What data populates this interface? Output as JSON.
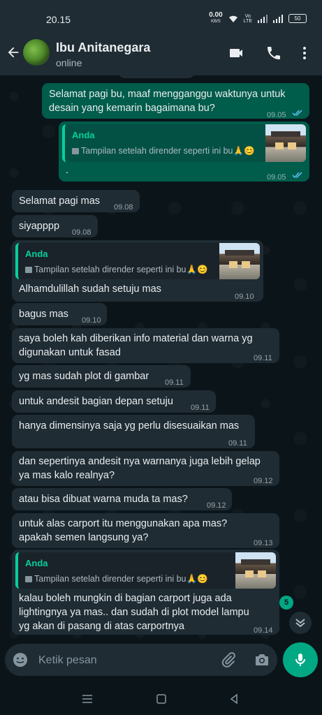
{
  "status_bar": {
    "time": "20.15",
    "net_speed_value": "0.00",
    "net_speed_unit": "KB/S",
    "volte_top": "Vo",
    "volte_bottom": "LTE",
    "battery": "50"
  },
  "header": {
    "contact_name": "Ibu Anitanegara",
    "presence": "online"
  },
  "colors": {
    "header_bg": "#1f2c34",
    "incoming_bubble": "#1f2c34",
    "outgoing_bubble": "#005c4b",
    "accent": "#00a884",
    "read_ticks": "#53bdeb",
    "quote_author": "#06cf9c"
  },
  "messages": [
    {
      "dir": "out",
      "lines": [
        "Selamat pagi bu, maaf mengganggu waktunya untuk",
        "desain yang kemarin bagaimana bu?"
      ],
      "time": "09.05",
      "status": "read"
    },
    {
      "dir": "out",
      "quote": {
        "author": "Anda",
        "text": "Tampilan setelah dirender seperti ini bu🙏😊"
      },
      "lines": [
        "."
      ],
      "time": "09.05",
      "status": "read"
    },
    {
      "dir": "in",
      "lines": [
        "Selamat pagi mas"
      ],
      "time": "09.08"
    },
    {
      "dir": "in",
      "lines": [
        "siyapppp"
      ],
      "time": "09.08"
    },
    {
      "dir": "in",
      "quote": {
        "author": "Anda",
        "text": "Tampilan setelah dirender seperti ini bu🙏😊"
      },
      "lines": [
        "Alhamdulillah sudah setuju mas"
      ],
      "time": "09.10"
    },
    {
      "dir": "in",
      "lines": [
        "bagus mas"
      ],
      "time": "09.10"
    },
    {
      "dir": "in",
      "lines": [
        "saya boleh kah diberikan info material dan warna yg",
        "digunakan untuk fasad"
      ],
      "time": "09.11"
    },
    {
      "dir": "in",
      "lines": [
        "yg mas sudah plot di gambar"
      ],
      "time": "09.11"
    },
    {
      "dir": "in",
      "lines": [
        "untuk andesit bagian depan setuju"
      ],
      "time": "09.11"
    },
    {
      "dir": "in",
      "lines": [
        "hanya dimensinya saja yg perlu disesuaikan mas"
      ],
      "time": "09.11"
    },
    {
      "dir": "in",
      "lines": [
        "dan sepertinya andesit nya warnanya juga lebih gelap",
        "ya mas kalo realnya?"
      ],
      "time": "09.12"
    },
    {
      "dir": "in",
      "lines": [
        "atau bisa dibuat warna muda ta mas?"
      ],
      "time": "09.12"
    },
    {
      "dir": "in",
      "lines": [
        "untuk alas carport itu menggunakan apa mas?",
        "apakah semen langsung ya?"
      ],
      "time": "09.13"
    },
    {
      "dir": "in",
      "quote": {
        "author": "Anda",
        "text": "Tampilan setelah dirender seperti ini bu🙏😊"
      },
      "lines": [
        "kalau boleh mungkin di bagian carport juga ada",
        "lightingnya ya mas.. dan sudah di plot model lampu",
        "yg akan di pasang di atas carportnya"
      ],
      "time": "09.14"
    }
  ],
  "unread_badge": "5",
  "composer": {
    "placeholder": "Ketik pesan"
  },
  "icons": {
    "back": "arrow-left-icon",
    "video": "video-call-icon",
    "call": "phone-icon",
    "menu": "more-vert-icon",
    "emoji": "emoji-icon",
    "attach": "paperclip-icon",
    "camera": "camera-icon",
    "mic": "microphone-icon",
    "scroll": "double-chevron-down-icon"
  }
}
